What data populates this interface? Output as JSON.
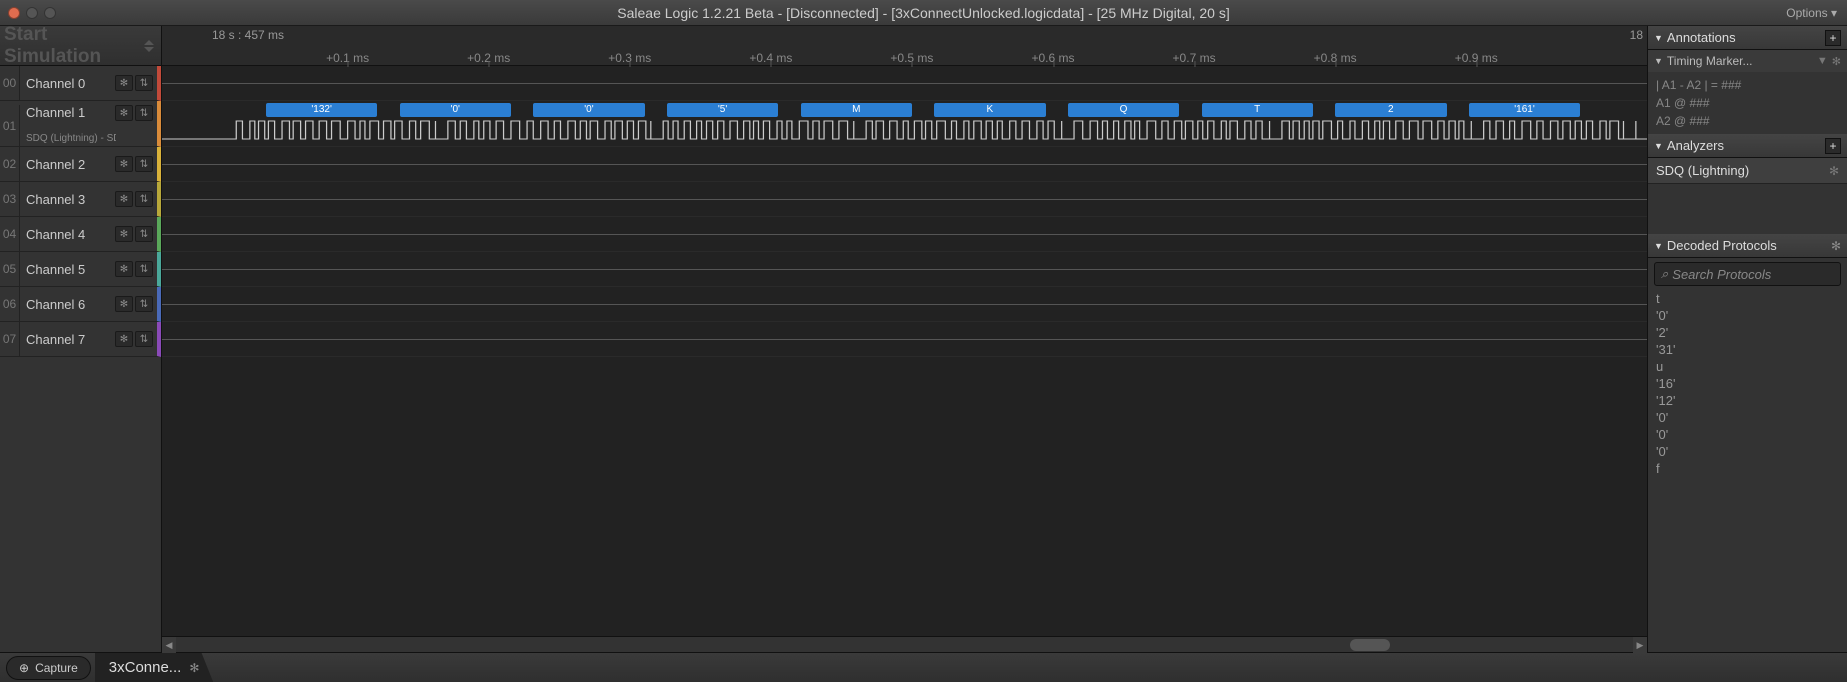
{
  "title": "Saleae Logic 1.2.21 Beta - [Disconnected] - [3xConnectUnlocked.logicdata] - [25 MHz Digital, 20 s]",
  "options_label": "Options ▾",
  "start_sim": "Start Simulation",
  "channels": [
    {
      "num": "00",
      "name": "Channel 0",
      "color": "#c24a3a"
    },
    {
      "num": "01",
      "name": "Channel 1",
      "sub": "SDQ (Lightning) - SDQ (Li",
      "color": "#d98b3a",
      "tall": true
    },
    {
      "num": "02",
      "name": "Channel 2",
      "color": "#d9b23a"
    },
    {
      "num": "03",
      "name": "Channel 3",
      "color": "#b8a83a"
    },
    {
      "num": "04",
      "name": "Channel 4",
      "color": "#5aa85a"
    },
    {
      "num": "05",
      "name": "Channel 5",
      "color": "#4aa89a"
    },
    {
      "num": "06",
      "name": "Channel 6",
      "color": "#4a6ab8"
    },
    {
      "num": "07",
      "name": "Channel 7",
      "color": "#8a4ab8"
    }
  ],
  "time_position": "18 s : 457 ms",
  "time_end": "18",
  "ticks": [
    {
      "pct": 12.5,
      "label": "+0.1 ms"
    },
    {
      "pct": 22.0,
      "label": "+0.2 ms"
    },
    {
      "pct": 31.5,
      "label": "+0.3 ms"
    },
    {
      "pct": 41.0,
      "label": "+0.4 ms"
    },
    {
      "pct": 50.5,
      "label": "+0.5 ms"
    },
    {
      "pct": 60.0,
      "label": "+0.6 ms"
    },
    {
      "pct": 69.5,
      "label": "+0.7 ms"
    },
    {
      "pct": 79.0,
      "label": "+0.8 ms"
    },
    {
      "pct": 88.5,
      "label": "+0.9 ms"
    }
  ],
  "decoded_bytes": [
    {
      "start": 7.0,
      "width": 7.5,
      "label": "'132'"
    },
    {
      "start": 16.0,
      "width": 7.5,
      "label": "'0'"
    },
    {
      "start": 25.0,
      "width": 7.5,
      "label": "'0'"
    },
    {
      "start": 34.0,
      "width": 7.5,
      "label": "'5'"
    },
    {
      "start": 43.0,
      "width": 7.5,
      "label": "M"
    },
    {
      "start": 52.0,
      "width": 7.5,
      "label": "K"
    },
    {
      "start": 61.0,
      "width": 7.5,
      "label": "Q"
    },
    {
      "start": 70.0,
      "width": 7.5,
      "label": "T"
    },
    {
      "start": 79.0,
      "width": 7.5,
      "label": "2"
    },
    {
      "start": 88.0,
      "width": 7.5,
      "label": "'161'"
    }
  ],
  "annotations": {
    "header": "Annotations",
    "timing_header": "Timing Marker...",
    "rows": [
      "| A1 - A2 | = ###",
      "A1  @  ###",
      "A2  @  ###"
    ]
  },
  "analyzers": {
    "header": "Analyzers",
    "items": [
      "SDQ (Lightning)"
    ]
  },
  "decoded": {
    "header": "Decoded Protocols",
    "search_placeholder": "Search Protocols",
    "items": [
      "t",
      "'0'",
      "'2'",
      "'31'",
      "u",
      "'16'",
      "'12'",
      "'0'",
      "'0'",
      "'0'",
      "f"
    ]
  },
  "tabs": {
    "capture": "Capture",
    "file": "3xConne..."
  }
}
